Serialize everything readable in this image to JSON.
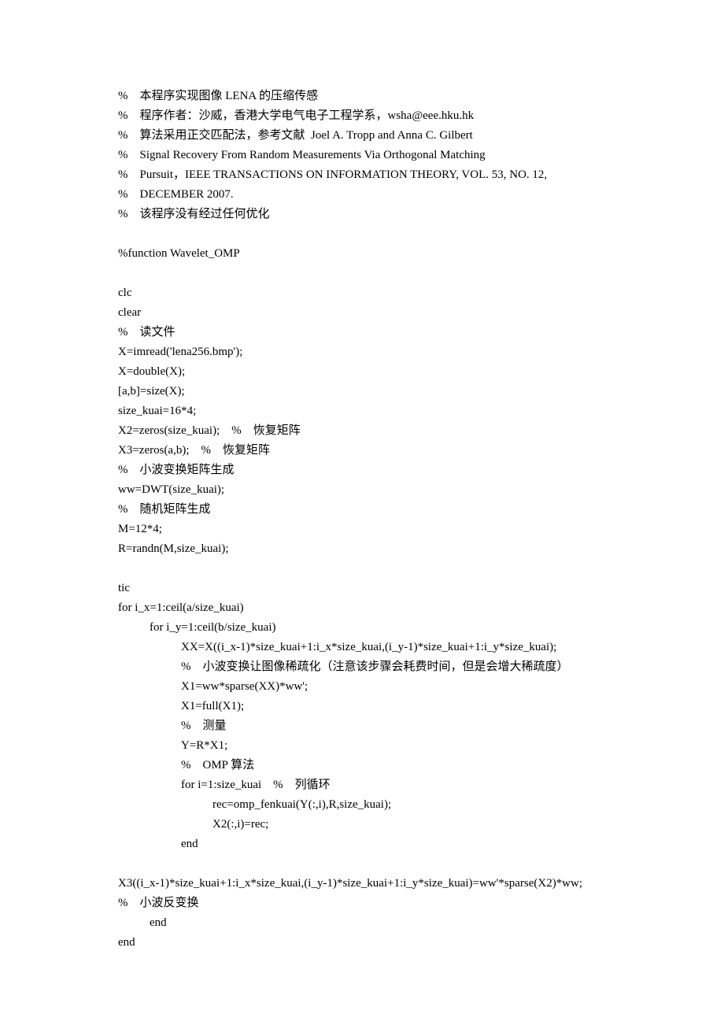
{
  "lines": [
    {
      "cls": "line",
      "text": "%    本程序实现图像 LENA 的压缩传感"
    },
    {
      "cls": "line",
      "text": "%    程序作者：沙威，香港大学电气电子工程学系，wsha@eee.hku.hk"
    },
    {
      "cls": "line",
      "text": "%    算法采用正交匹配法，参考文献  Joel A. Tropp and Anna C. Gilbert"
    },
    {
      "cls": "line",
      "text": "%    Signal Recovery From Random Measurements Via Orthogonal Matching"
    },
    {
      "cls": "line",
      "text": "%    Pursuit，IEEE TRANSACTIONS ON INFORMATION THEORY, VOL. 53, NO. 12,"
    },
    {
      "cls": "line",
      "text": "%    DECEMBER 2007."
    },
    {
      "cls": "line",
      "text": "%    该程序没有经过任何优化"
    },
    {
      "cls": "blank",
      "text": ""
    },
    {
      "cls": "line",
      "text": "%function Wavelet_OMP"
    },
    {
      "cls": "blank",
      "text": ""
    },
    {
      "cls": "line",
      "text": "clc"
    },
    {
      "cls": "line",
      "text": "clear"
    },
    {
      "cls": "line",
      "text": "%    读文件"
    },
    {
      "cls": "line",
      "text": "X=imread('lena256.bmp');"
    },
    {
      "cls": "line",
      "text": "X=double(X);"
    },
    {
      "cls": "line",
      "text": "[a,b]=size(X);"
    },
    {
      "cls": "line",
      "text": "size_kuai=16*4;"
    },
    {
      "cls": "line",
      "text": "X2=zeros(size_kuai);    %    恢复矩阵"
    },
    {
      "cls": "line",
      "text": "X3=zeros(a,b);    %    恢复矩阵"
    },
    {
      "cls": "line",
      "text": "%    小波变换矩阵生成"
    },
    {
      "cls": "line",
      "text": "ww=DWT(size_kuai);"
    },
    {
      "cls": "line",
      "text": "%    随机矩阵生成"
    },
    {
      "cls": "line",
      "text": "M=12*4;"
    },
    {
      "cls": "line",
      "text": "R=randn(M,size_kuai);"
    },
    {
      "cls": "blank",
      "text": ""
    },
    {
      "cls": "line",
      "text": "tic"
    },
    {
      "cls": "line",
      "text": "for i_x=1:ceil(a/size_kuai)"
    },
    {
      "cls": "line indent1",
      "text": "for i_y=1:ceil(b/size_kuai)"
    },
    {
      "cls": "line indent2",
      "text": "XX=X((i_x-1)*size_kuai+1:i_x*size_kuai,(i_y-1)*size_kuai+1:i_y*size_kuai);"
    },
    {
      "cls": "line indent2",
      "text": "%    小波变换让图像稀疏化（注意该步骤会耗费时间，但是会增大稀疏度）"
    },
    {
      "cls": "line indent2",
      "text": "X1=ww*sparse(XX)*ww';"
    },
    {
      "cls": "line indent2",
      "text": "X1=full(X1);"
    },
    {
      "cls": "line indent2",
      "text": "%    测量"
    },
    {
      "cls": "line indent2",
      "text": "Y=R*X1;"
    },
    {
      "cls": "line indent2",
      "text": "%    OMP 算法"
    },
    {
      "cls": "line indent2",
      "text": "for i=1:size_kuai    %    列循环"
    },
    {
      "cls": "line indent3",
      "text": "rec=omp_fenkuai(Y(:,i),R,size_kuai);"
    },
    {
      "cls": "line indent3",
      "text": "X2(:,i)=rec;"
    },
    {
      "cls": "line indent2",
      "text": "end"
    },
    {
      "cls": "blank",
      "text": ""
    },
    {
      "cls": "line",
      "text": "X3((i_x-1)*size_kuai+1:i_x*size_kuai,(i_y-1)*size_kuai+1:i_y*size_kuai)=ww'*sparse(X2)*ww;"
    },
    {
      "cls": "line",
      "text": "%    小波反变换"
    },
    {
      "cls": "line indent1",
      "text": "end"
    },
    {
      "cls": "line",
      "text": "end"
    }
  ]
}
